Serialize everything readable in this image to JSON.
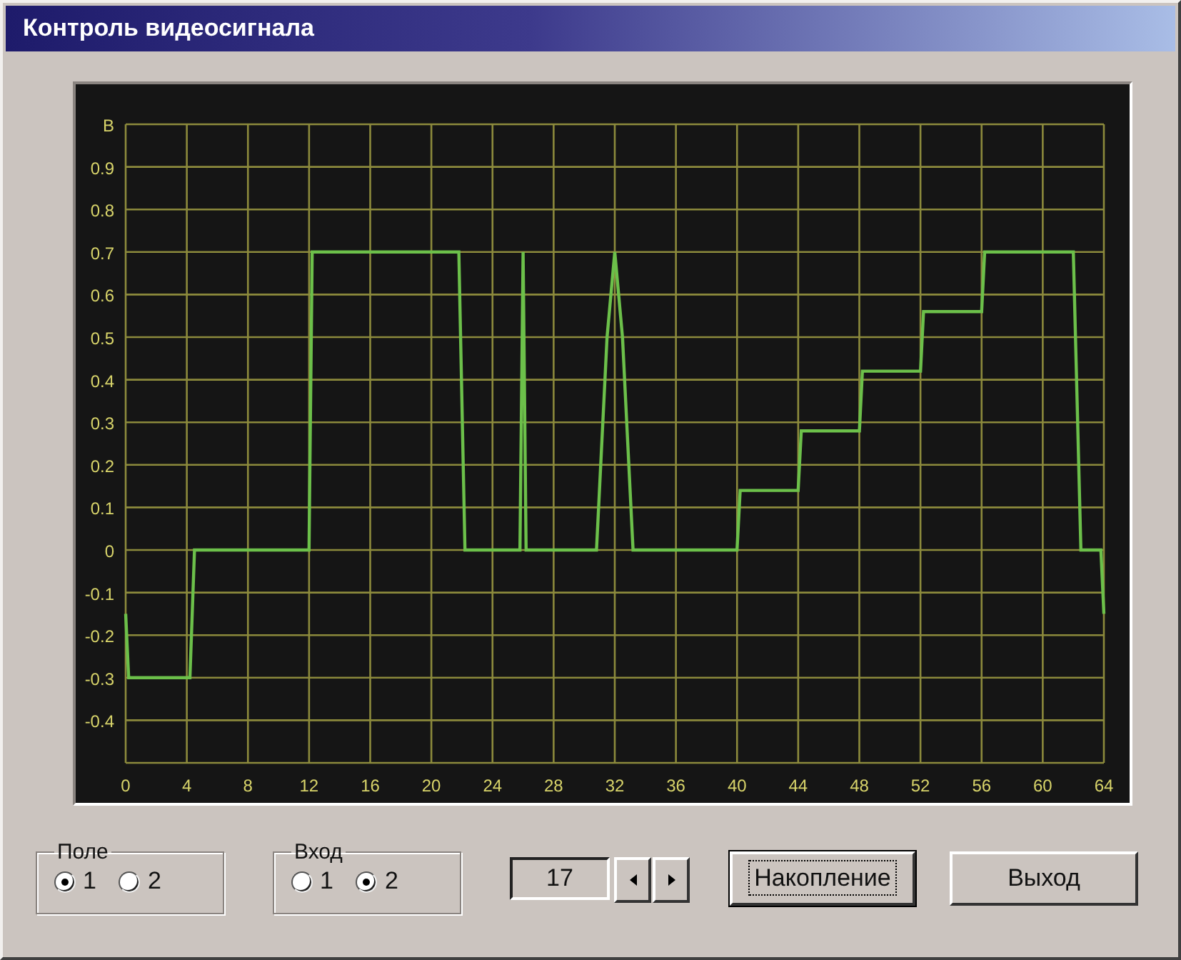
{
  "window": {
    "title": "Контроль видеосигнала"
  },
  "chart": {
    "chart_data": {
      "type": "line",
      "x": [
        0,
        0.2,
        4.2,
        4.5,
        12,
        12.2,
        21.8,
        22.2,
        25.8,
        26,
        26.2,
        30.8,
        31.5,
        32,
        32.5,
        33.2,
        40,
        40.2,
        44,
        44.2,
        48,
        48.2,
        52,
        52.2,
        56,
        56.2,
        62,
        62.5,
        63.8,
        64
      ],
      "series": [
        {
          "color": "#6cc04a",
          "values": [
            -0.15,
            -0.3,
            -0.3,
            0,
            0,
            0.7,
            0.7,
            0,
            0,
            0.7,
            0,
            0,
            0.5,
            0.7,
            0.5,
            0,
            0,
            0.14,
            0.14,
            0.28,
            0.28,
            0.42,
            0.42,
            0.56,
            0.56,
            0.7,
            0.7,
            0,
            0,
            -0.15
          ]
        }
      ],
      "grid": true,
      "xlim": [
        0,
        64
      ],
      "ylim": [
        -0.5,
        1
      ],
      "xticks": [
        0,
        4,
        8,
        12,
        16,
        20,
        24,
        28,
        32,
        36,
        40,
        44,
        48,
        52,
        56,
        60,
        64
      ],
      "yticks": [
        {
          "value": 1,
          "label": "В"
        },
        0.9,
        0.8,
        0.7,
        0.6,
        0.5,
        0.4,
        0.3,
        0.2,
        0.1,
        0,
        -0.1,
        -0.2,
        -0.3,
        -0.4
      ]
    }
  },
  "field_group": {
    "label": "Поле",
    "options": [
      {
        "label": "1",
        "selected": true
      },
      {
        "label": "2",
        "selected": false
      }
    ]
  },
  "input_group": {
    "label": "Вход",
    "options": [
      {
        "label": "1",
        "selected": false
      },
      {
        "label": "2",
        "selected": true
      }
    ]
  },
  "counter": {
    "value": "17"
  },
  "buttons": [
    {
      "label": "Накопление",
      "focused": true
    },
    {
      "label": "Выход",
      "focused": false
    }
  ]
}
